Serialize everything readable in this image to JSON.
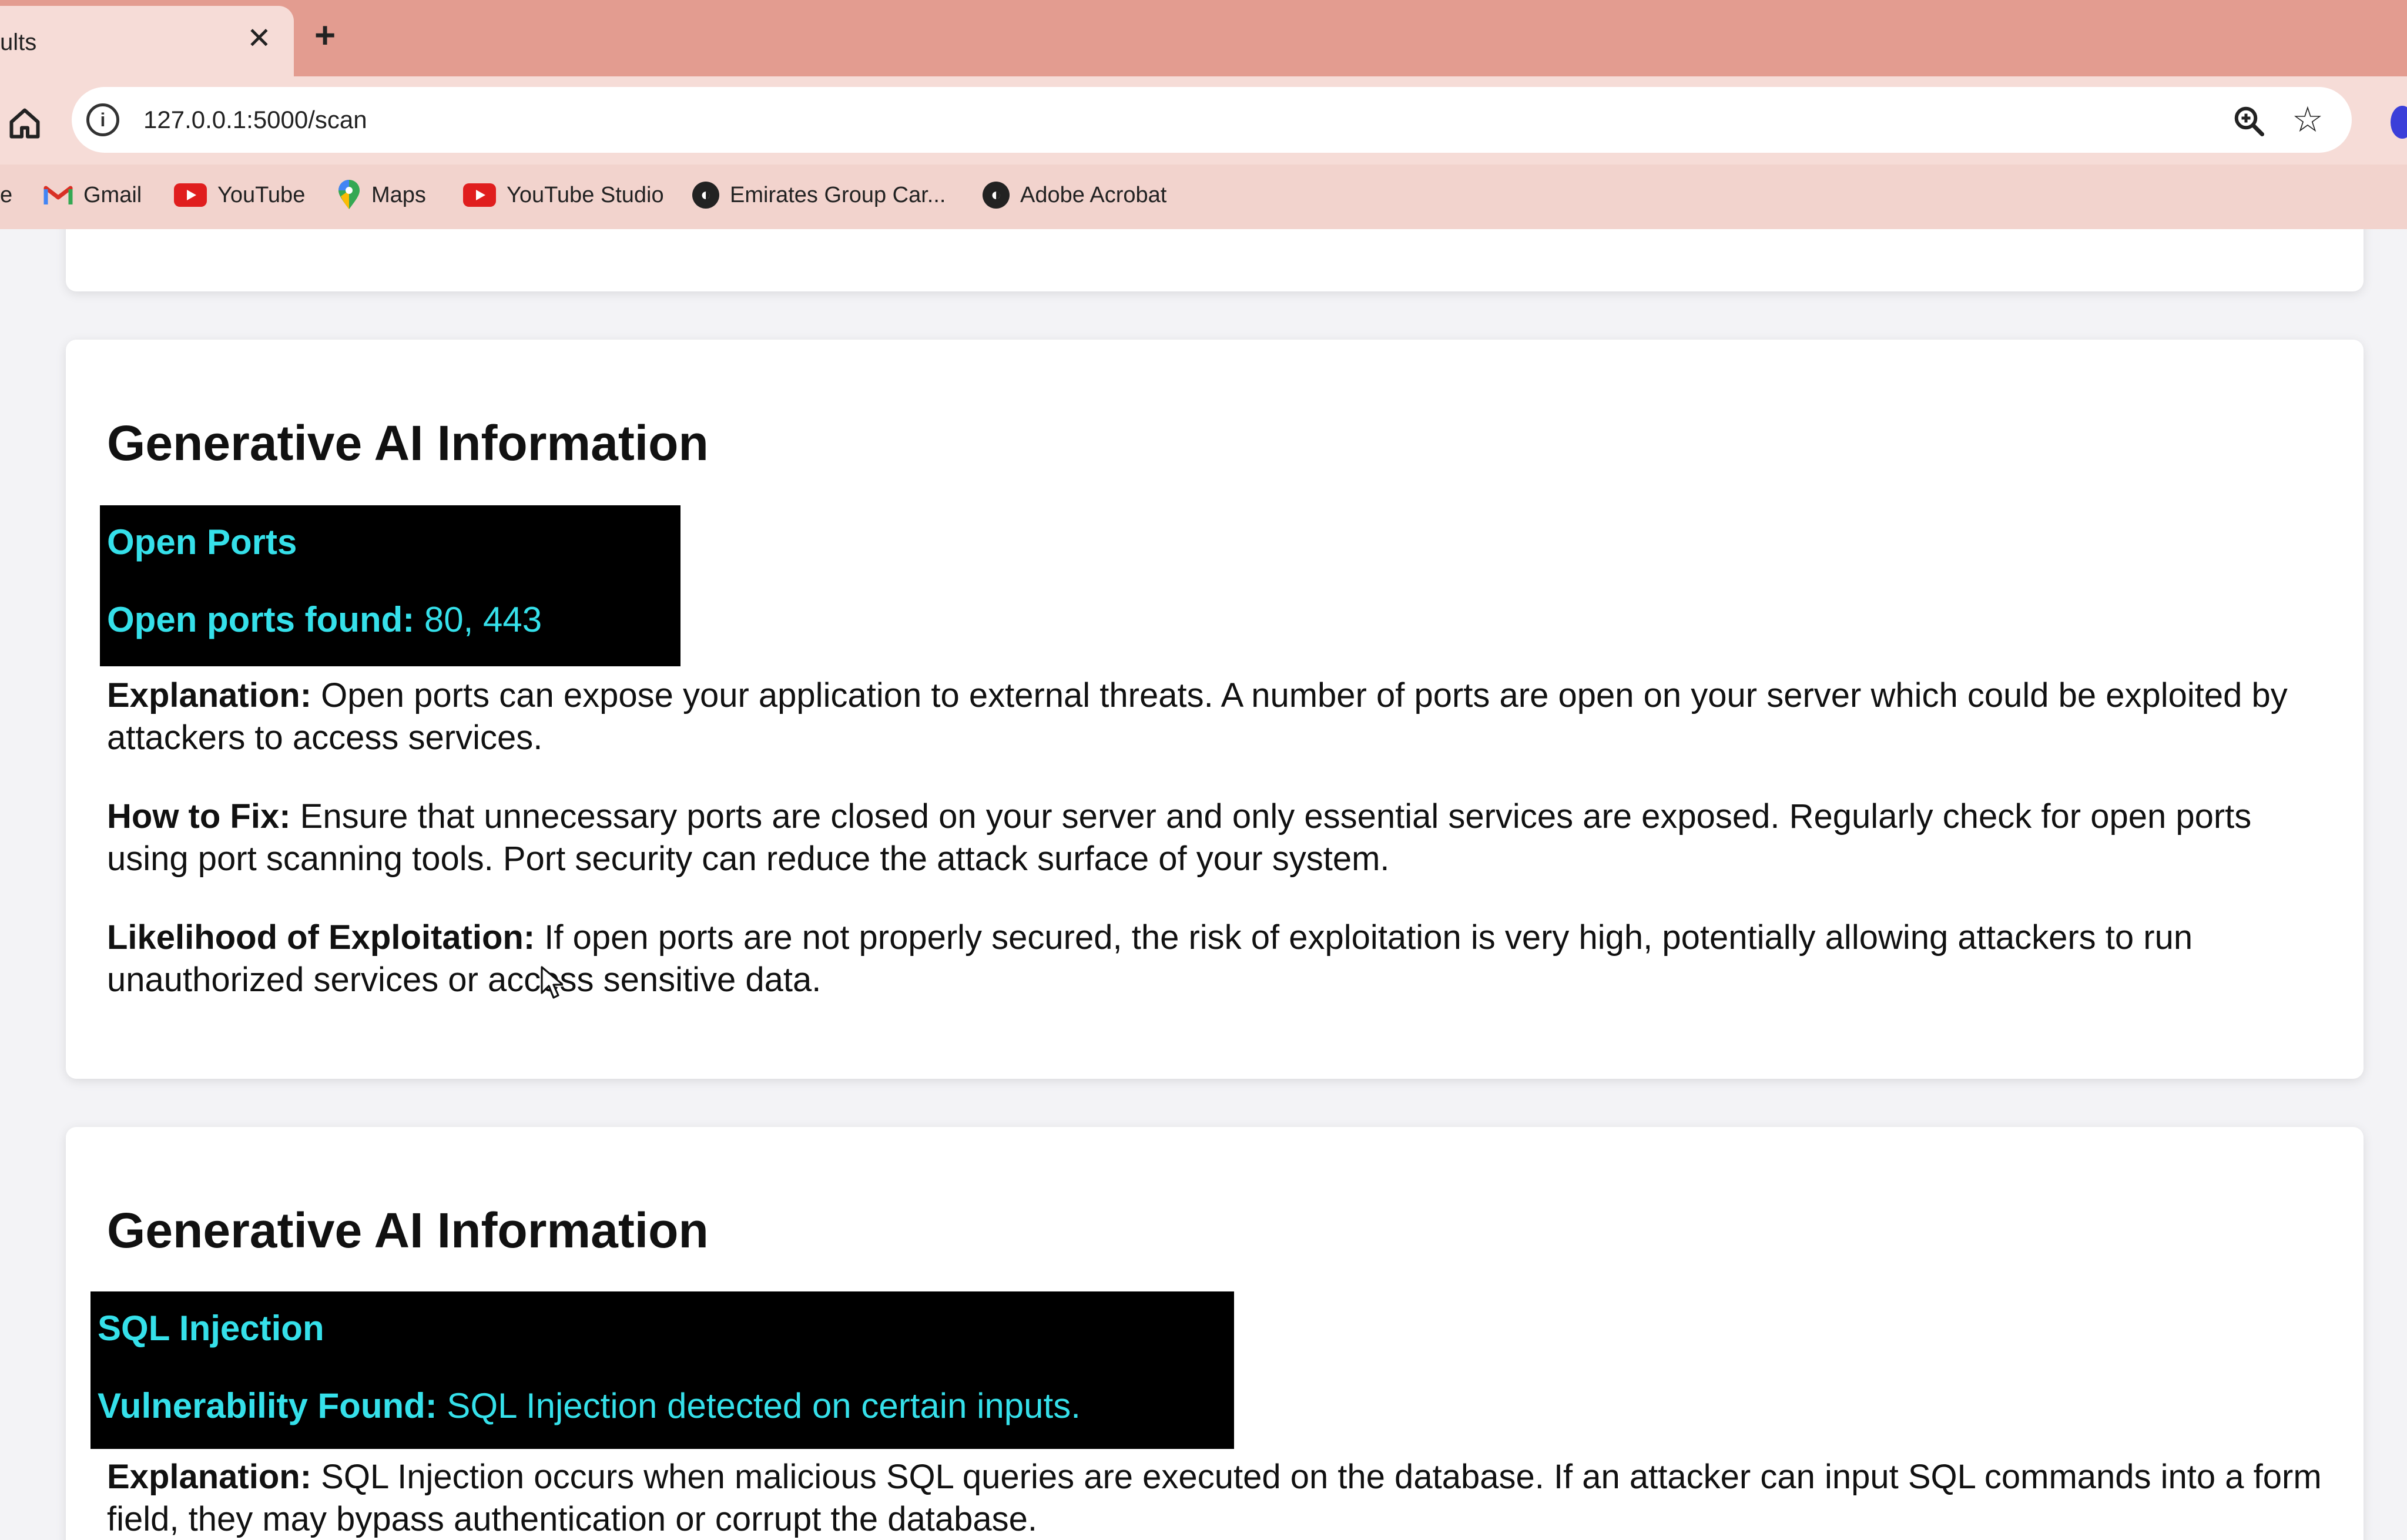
{
  "browser": {
    "tab_title": "ults",
    "tab_close": "✕",
    "new_tab": "+",
    "url": "127.0.0.1:5000/scan",
    "site_info_glyph": "i",
    "bookmarks": [
      {
        "label": "e",
        "icon": "none"
      },
      {
        "label": "Gmail",
        "icon": "gmail-icon"
      },
      {
        "label": "YouTube",
        "icon": "youtube-icon"
      },
      {
        "label": "Maps",
        "icon": "maps-icon"
      },
      {
        "label": "YouTube Studio",
        "icon": "youtube-studio-icon"
      },
      {
        "label": "Emirates Group Car...",
        "icon": "globe-icon"
      },
      {
        "label": "Adobe Acrobat",
        "icon": "globe-icon"
      }
    ]
  },
  "cards": [
    {
      "title": "Generative AI Information",
      "heading": "Open Ports",
      "finding_label": "Open ports found:",
      "finding_value": " 80, 443",
      "explanation_label": "Explanation:",
      "explanation_text": " Open ports can expose your application to external threats. A number of ports are open on your server which could be exploited by attackers to access services.",
      "fix_label": "How to Fix:",
      "fix_text": " Ensure that unnecessary ports are closed on your server and only essential services are exposed. Regularly check for open ports using port scanning tools. Port security can reduce the attack surface of your system.",
      "likelihood_label": "Likelihood of Exploitation:",
      "likelihood_text": " If open ports are not properly secured, the risk of exploitation is very high, potentially allowing attackers to run unauthorized services or access sensitive data."
    },
    {
      "title": "Generative AI Information",
      "heading": "SQL Injection",
      "finding_label": "Vulnerability Found:",
      "finding_value": " SQL Injection detected on certain inputs.",
      "explanation_label": "Explanation:",
      "explanation_text": " SQL Injection occurs when malicious SQL queries are executed on the database. If an attacker can input SQL commands into a form field, they may bypass authentication or corrupt the database."
    }
  ],
  "colors": {
    "tabbar": "#e39c90",
    "toolbar": "#f6dcd7",
    "highlight_bg": "#000000",
    "highlight_text": "#35e0ea"
  }
}
